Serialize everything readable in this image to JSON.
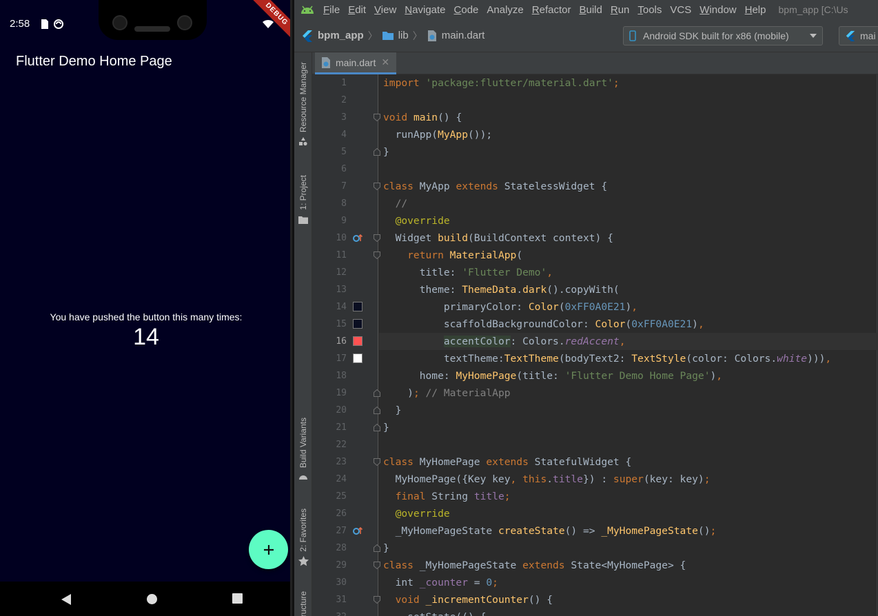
{
  "phone": {
    "status": {
      "time": "2:58",
      "debug_banner": "DEBUG"
    },
    "app_bar_title": "Flutter Demo Home Page",
    "counter_label": "You have pushed the button this many times:",
    "counter_value": "14",
    "fab_symbol": "+",
    "colors": {
      "background": "#010020",
      "fab": "#5dfcc3"
    }
  },
  "ide": {
    "menu": [
      {
        "mn": "F",
        "rest": "ile"
      },
      {
        "mn": "E",
        "rest": "dit"
      },
      {
        "mn": "V",
        "rest": "iew"
      },
      {
        "mn": "N",
        "rest": "avigate"
      },
      {
        "mn": "C",
        "rest": "ode"
      },
      {
        "mn": "",
        "rest": "Analyze"
      },
      {
        "mn": "R",
        "rest": "efactor"
      },
      {
        "mn": "B",
        "rest": "uild"
      },
      {
        "mn": "R",
        "rest": "un"
      },
      {
        "mn": "T",
        "rest": "ools"
      },
      {
        "mn": "",
        "rest": "VCS"
      },
      {
        "mn": "W",
        "rest": "indow"
      },
      {
        "mn": "H",
        "rest": "elp"
      }
    ],
    "window_title": "bpm_app [C:\\Us",
    "breadcrumbs": {
      "project": "bpm_app",
      "folder": "lib",
      "file": "main.dart"
    },
    "device": "Android SDK built for x86 (mobile)",
    "run_config": "mai",
    "side_tabs": [
      "Resource Manager",
      "1: Project",
      "Build Variants",
      "2: Favorites",
      "ructure"
    ],
    "editor_tab": "main.dart",
    "current_line": 16,
    "swatches": {
      "14": "#0A0E21",
      "15": "#0A0E21",
      "16": "#FF5252",
      "17": "#FFFFFF"
    },
    "code_lines": [
      [
        [
          "k",
          "import "
        ],
        [
          "s",
          "'package:flutter/material.dart'"
        ],
        [
          "k",
          ";"
        ]
      ],
      [],
      [
        [
          "k",
          "void "
        ],
        [
          "f",
          "main"
        ],
        [
          "w",
          "() {"
        ]
      ],
      [
        [
          "w",
          "  runApp("
        ],
        [
          "f",
          "MyApp"
        ],
        [
          "w",
          "());"
        ]
      ],
      [
        [
          "w",
          "}"
        ]
      ],
      [],
      [
        [
          "k",
          "class "
        ],
        [
          "w",
          "MyApp "
        ],
        [
          "k",
          "extends "
        ],
        [
          "w",
          "StatelessWidget {"
        ]
      ],
      [
        [
          "c",
          "  //"
        ]
      ],
      [
        [
          "a",
          "  @override"
        ]
      ],
      [
        [
          "w",
          "  Widget "
        ],
        [
          "f",
          "build"
        ],
        [
          "w",
          "(BuildContext context) {"
        ]
      ],
      [
        [
          "k",
          "    return "
        ],
        [
          "f",
          "MaterialApp"
        ],
        [
          "w",
          "("
        ]
      ],
      [
        [
          "w",
          "      title: "
        ],
        [
          "s",
          "'Flutter Demo'"
        ],
        [
          "k",
          ","
        ]
      ],
      [
        [
          "w",
          "      theme: "
        ],
        [
          "f",
          "ThemeData"
        ],
        [
          "w",
          "."
        ],
        [
          "f",
          "dark"
        ],
        [
          "w",
          "().copyWith("
        ]
      ],
      [
        [
          "w",
          "          primaryColor: "
        ],
        [
          "f",
          "Color"
        ],
        [
          "w",
          "("
        ],
        [
          "n",
          "0xFF0A0E21"
        ],
        [
          "w",
          ")"
        ],
        [
          "k",
          ","
        ]
      ],
      [
        [
          "w",
          "          scaffoldBackgroundColor: "
        ],
        [
          "f",
          "Color"
        ],
        [
          "w",
          "("
        ],
        [
          "n",
          "0xFF0A0E21"
        ],
        [
          "w",
          ")"
        ],
        [
          "k",
          ","
        ]
      ],
      [
        [
          "w",
          "          "
        ],
        [
          "hl",
          "accentColor"
        ],
        [
          "w",
          ": Colors."
        ],
        [
          "i",
          "redAccent"
        ],
        [
          "k",
          ","
        ]
      ],
      [
        [
          "w",
          "          textTheme:"
        ],
        [
          "f",
          "TextTheme"
        ],
        [
          "w",
          "(bodyText2: "
        ],
        [
          "f",
          "TextStyle"
        ],
        [
          "w",
          "(color: Colors."
        ],
        [
          "i",
          "white"
        ],
        [
          "w",
          ")))"
        ],
        [
          "k",
          ","
        ]
      ],
      [
        [
          "w",
          "      home: "
        ],
        [
          "f",
          "MyHomePage"
        ],
        [
          "w",
          "(title: "
        ],
        [
          "s",
          "'Flutter Demo Home Page'"
        ],
        [
          "w",
          ")"
        ],
        [
          "k",
          ","
        ]
      ],
      [
        [
          "w",
          "    )"
        ],
        [
          "k",
          ";"
        ],
        [
          "c",
          " // MaterialApp"
        ]
      ],
      [
        [
          "w",
          "  }"
        ]
      ],
      [
        [
          "w",
          "}"
        ]
      ],
      [],
      [
        [
          "k",
          "class "
        ],
        [
          "w",
          "MyHomePage "
        ],
        [
          "k",
          "extends "
        ],
        [
          "w",
          "StatefulWidget {"
        ]
      ],
      [
        [
          "w",
          "  MyHomePage({Key key"
        ],
        [
          "k",
          ", this"
        ],
        [
          "w",
          "."
        ],
        [
          "p",
          "title"
        ],
        [
          "w",
          "}) : "
        ],
        [
          "k",
          "super"
        ],
        [
          "w",
          "(key: key)"
        ],
        [
          "k",
          ";"
        ]
      ],
      [
        [
          "k",
          "  final "
        ],
        [
          "w",
          "String "
        ],
        [
          "p",
          "title"
        ],
        [
          "k",
          ";"
        ]
      ],
      [
        [
          "a",
          "  @override"
        ]
      ],
      [
        [
          "w",
          "  _MyHomePageState "
        ],
        [
          "f",
          "createState"
        ],
        [
          "w",
          "() => "
        ],
        [
          "f",
          "_MyHomePageState"
        ],
        [
          "w",
          "()"
        ],
        [
          "k",
          ";"
        ]
      ],
      [
        [
          "w",
          "}"
        ]
      ],
      [
        [
          "k",
          "class "
        ],
        [
          "w",
          "_MyHomePageState "
        ],
        [
          "k",
          "extends "
        ],
        [
          "w",
          "State<MyHomePage> {"
        ]
      ],
      [
        [
          "w",
          "  int "
        ],
        [
          "p",
          "_counter "
        ],
        [
          "w",
          "= "
        ],
        [
          "n",
          "0"
        ],
        [
          "k",
          ";"
        ]
      ],
      [
        [
          "k",
          "  void "
        ],
        [
          "f",
          "_incrementCounter"
        ],
        [
          "w",
          "() {"
        ]
      ],
      [
        [
          "w",
          "    setState(() {"
        ]
      ]
    ]
  }
}
